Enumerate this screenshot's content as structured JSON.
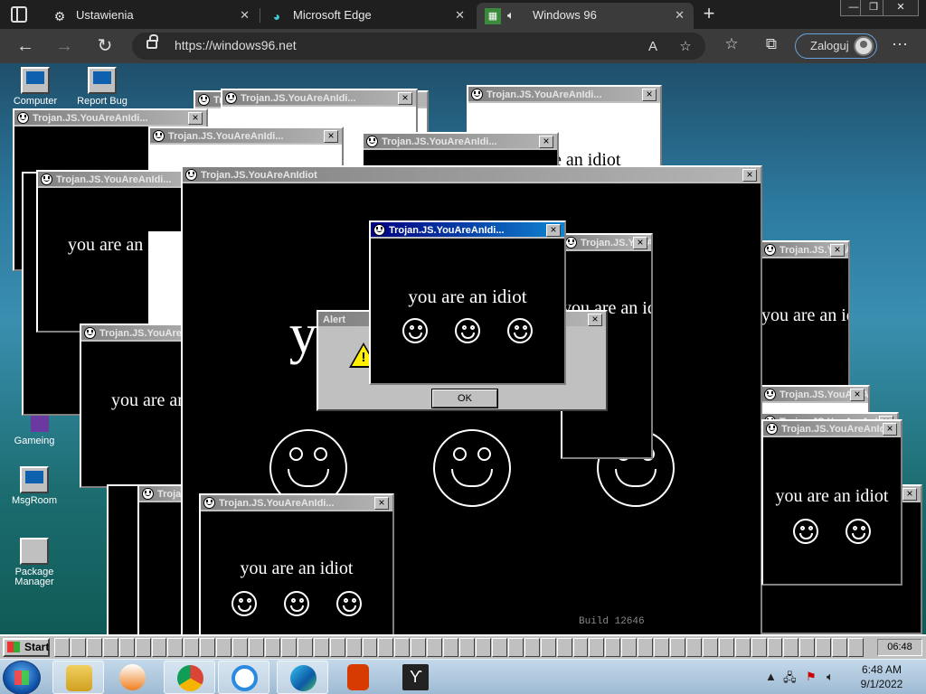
{
  "browser": {
    "tabs": [
      {
        "label": "Ustawienia",
        "icon": "gear-icon"
      },
      {
        "label": "Microsoft Edge",
        "icon": "edge-icon"
      },
      {
        "label": "Windows 96",
        "icon": "windows96-icon"
      }
    ],
    "url": "https://windows96.net",
    "login_label": "Zaloguj"
  },
  "desktop": {
    "icons": [
      {
        "label": "Computer"
      },
      {
        "label": "Report Bug"
      },
      {
        "label": "Gameing"
      },
      {
        "label": "MsgRoom"
      },
      {
        "label": "Package Manager"
      }
    ],
    "trojan_title": "Trojan.JS.YouAreAnIdiot",
    "trojan_title_short": "Trojan.JS.YouAreAnIdi...",
    "trojan_text": "you are an idiot",
    "trojan_big_text": "you are an idiot",
    "alert": {
      "title": "Alert",
      "ok": "OK"
    },
    "build_text": "Build 12646"
  },
  "w96_taskbar": {
    "start": "Start",
    "clock": "06:48"
  },
  "win7_taskbar": {
    "time": "6:48 AM",
    "date": "9/1/2022"
  },
  "colors": {
    "active_title": "#000080",
    "desktop": "#2d7aa0",
    "taskbar_w96": "#c0c0c0"
  }
}
